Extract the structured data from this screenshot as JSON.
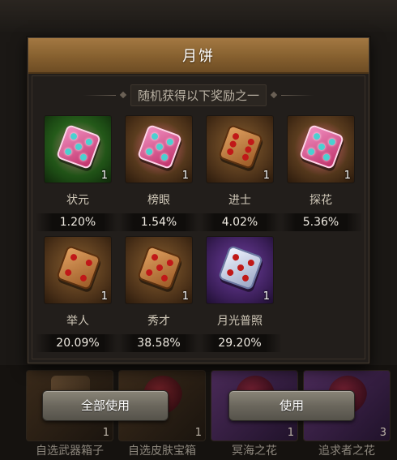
{
  "panel": {
    "title": "月饼",
    "subtitle": "随机获得以下奖励之一"
  },
  "rewards": [
    {
      "name": "状元",
      "rate": "1.20%",
      "count": "1",
      "rarity": "green",
      "dice": "pink"
    },
    {
      "name": "榜眼",
      "rate": "1.54%",
      "count": "1",
      "rarity": "orange",
      "dice": "pink"
    },
    {
      "name": "进士",
      "rate": "4.02%",
      "count": "1",
      "rarity": "orange",
      "dice": "wood"
    },
    {
      "name": "探花",
      "rate": "5.36%",
      "count": "1",
      "rarity": "orange",
      "dice": "pink"
    },
    {
      "name": "举人",
      "rate": "20.09%",
      "count": "1",
      "rarity": "orange",
      "dice": "wood"
    },
    {
      "name": "秀才",
      "rate": "38.58%",
      "count": "1",
      "rarity": "orange",
      "dice": "wood"
    },
    {
      "name": "月光普照",
      "rate": "29.20%",
      "count": "1",
      "rarity": "purple",
      "dice": "silver"
    }
  ],
  "buttons": {
    "use_all": "全部使用",
    "use": "使用"
  },
  "background_items": [
    {
      "name": "自选武器箱子",
      "count": "1"
    },
    {
      "name": "自选皮肤宝箱",
      "count": "1"
    },
    {
      "name": "冥海之花",
      "count": "1"
    },
    {
      "name": "追求者之花",
      "count": "3"
    }
  ],
  "colors": {
    "header": "#86602f",
    "panel": "#221e1b",
    "rarity_green": "#3d8a2a",
    "rarity_orange": "#8a6030",
    "rarity_purple": "#7040a0"
  }
}
